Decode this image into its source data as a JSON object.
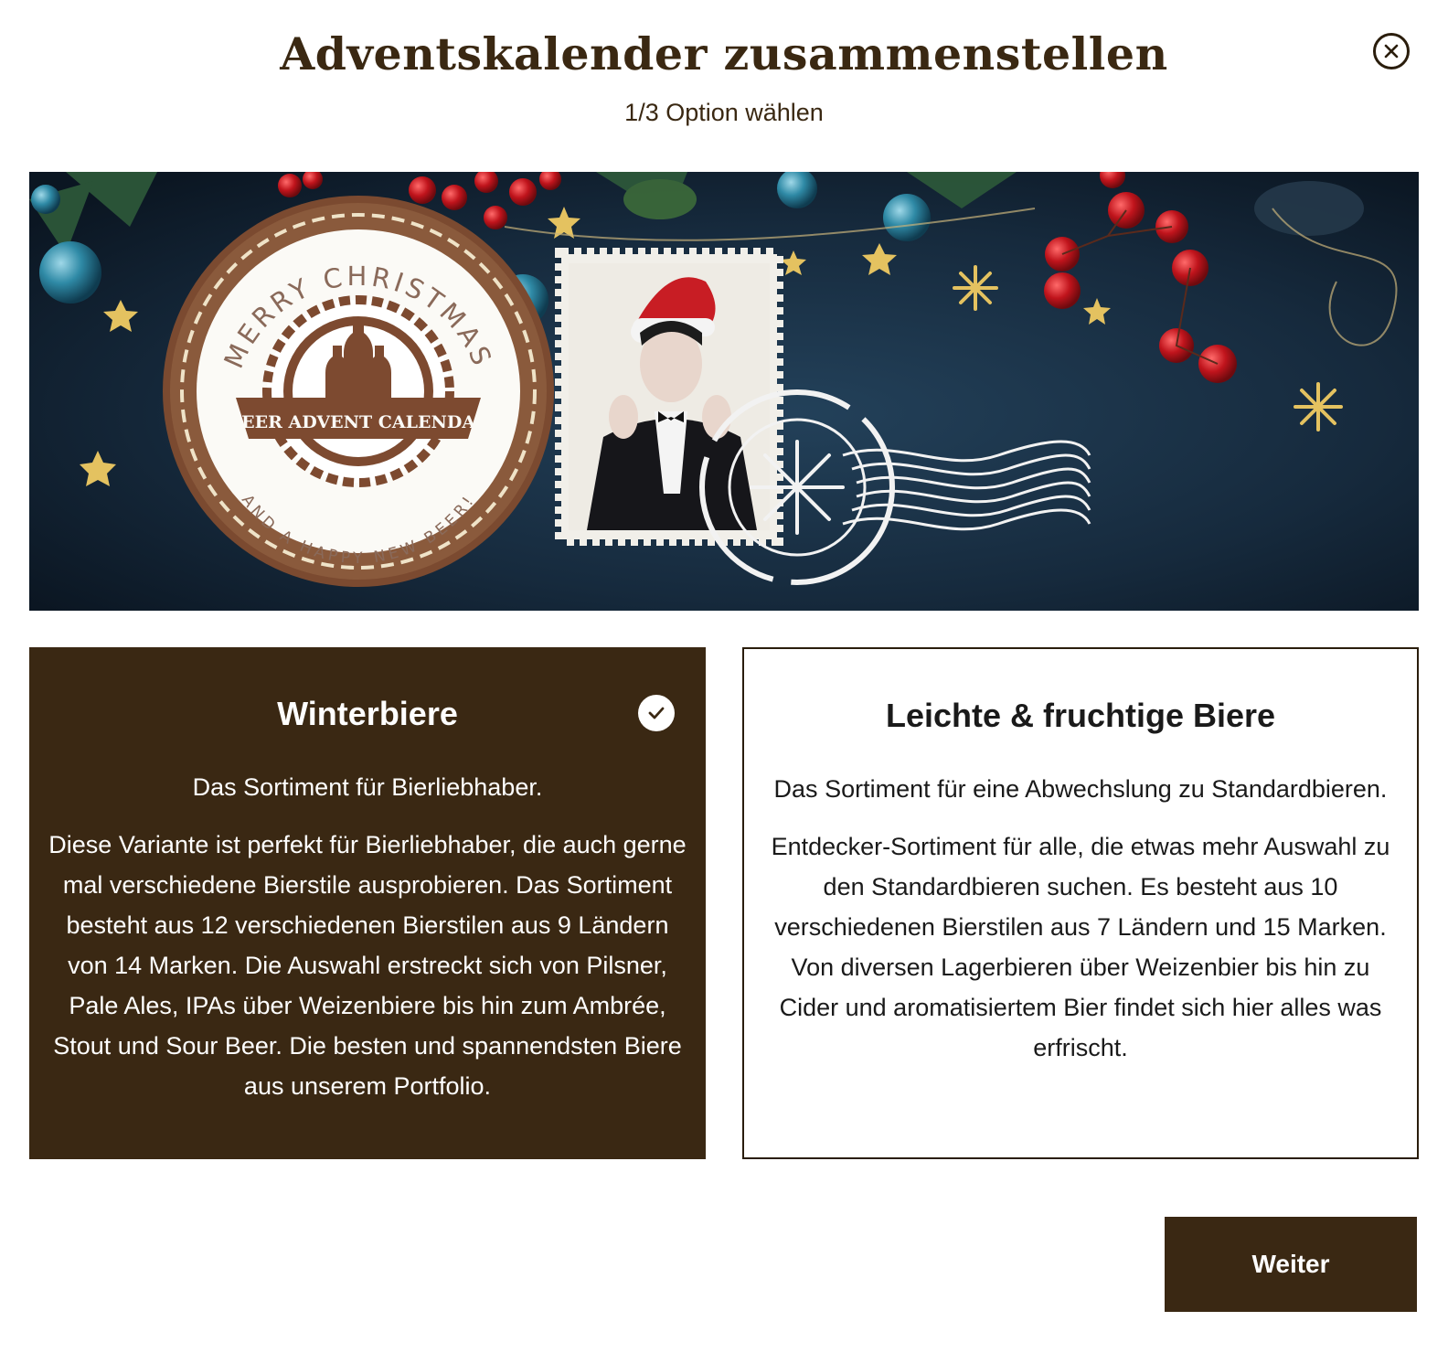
{
  "modal": {
    "title": "Adventskalender zusammenstellen",
    "step": "1/3 Option wählen",
    "close_icon": "close-icon"
  },
  "banner": {
    "coaster_top_text": "MERRY CHRISTMAS",
    "coaster_ribbon_text": "BEER ADVENT CALENDAR",
    "coaster_bottom_text": "AND A HAPPY NEW BEER!",
    "colors": {
      "background": "#16283a",
      "coaster": "#8a5a3c",
      "berries": "#c0141c",
      "stars": "#e4c260"
    }
  },
  "options": [
    {
      "title": "Winterbiere",
      "subtitle": "Das Sortiment für Bierliebhaber.",
      "description": "Diese Variante ist perfekt für Bierliebhaber, die auch gerne mal verschiedene Bierstile ausprobieren. Das Sortiment besteht aus 12 verschiedenen Bierstilen aus 9 Ländern von 14 Marken. Die Auswahl erstreckt sich von Pilsner, Pale Ales, IPAs über Weizenbiere bis hin zum Ambrée, Stout und Sour Beer. Die besten und spannendsten Biere aus unserem Portfolio.",
      "selected": true
    },
    {
      "title": "Leichte & fruchtige Biere",
      "subtitle": "Das Sortiment für eine Abwechslung zu Standardbieren.",
      "description": "Entdecker-Sortiment für alle, die etwas mehr Auswahl zu den Standardbieren suchen. Es besteht aus 10 verschiedenen Bierstilen aus 7 Ländern und 15 Marken. Von diversen Lagerbieren über Weizenbier bis hin zu Cider und aromatisiertem Bier findet sich hier alles was erfrischt.",
      "selected": false
    }
  ],
  "footer": {
    "next_label": "Weiter"
  },
  "colors": {
    "brand_dark": "#3a2813",
    "text": "#3a2812",
    "background": "#ffffff"
  }
}
